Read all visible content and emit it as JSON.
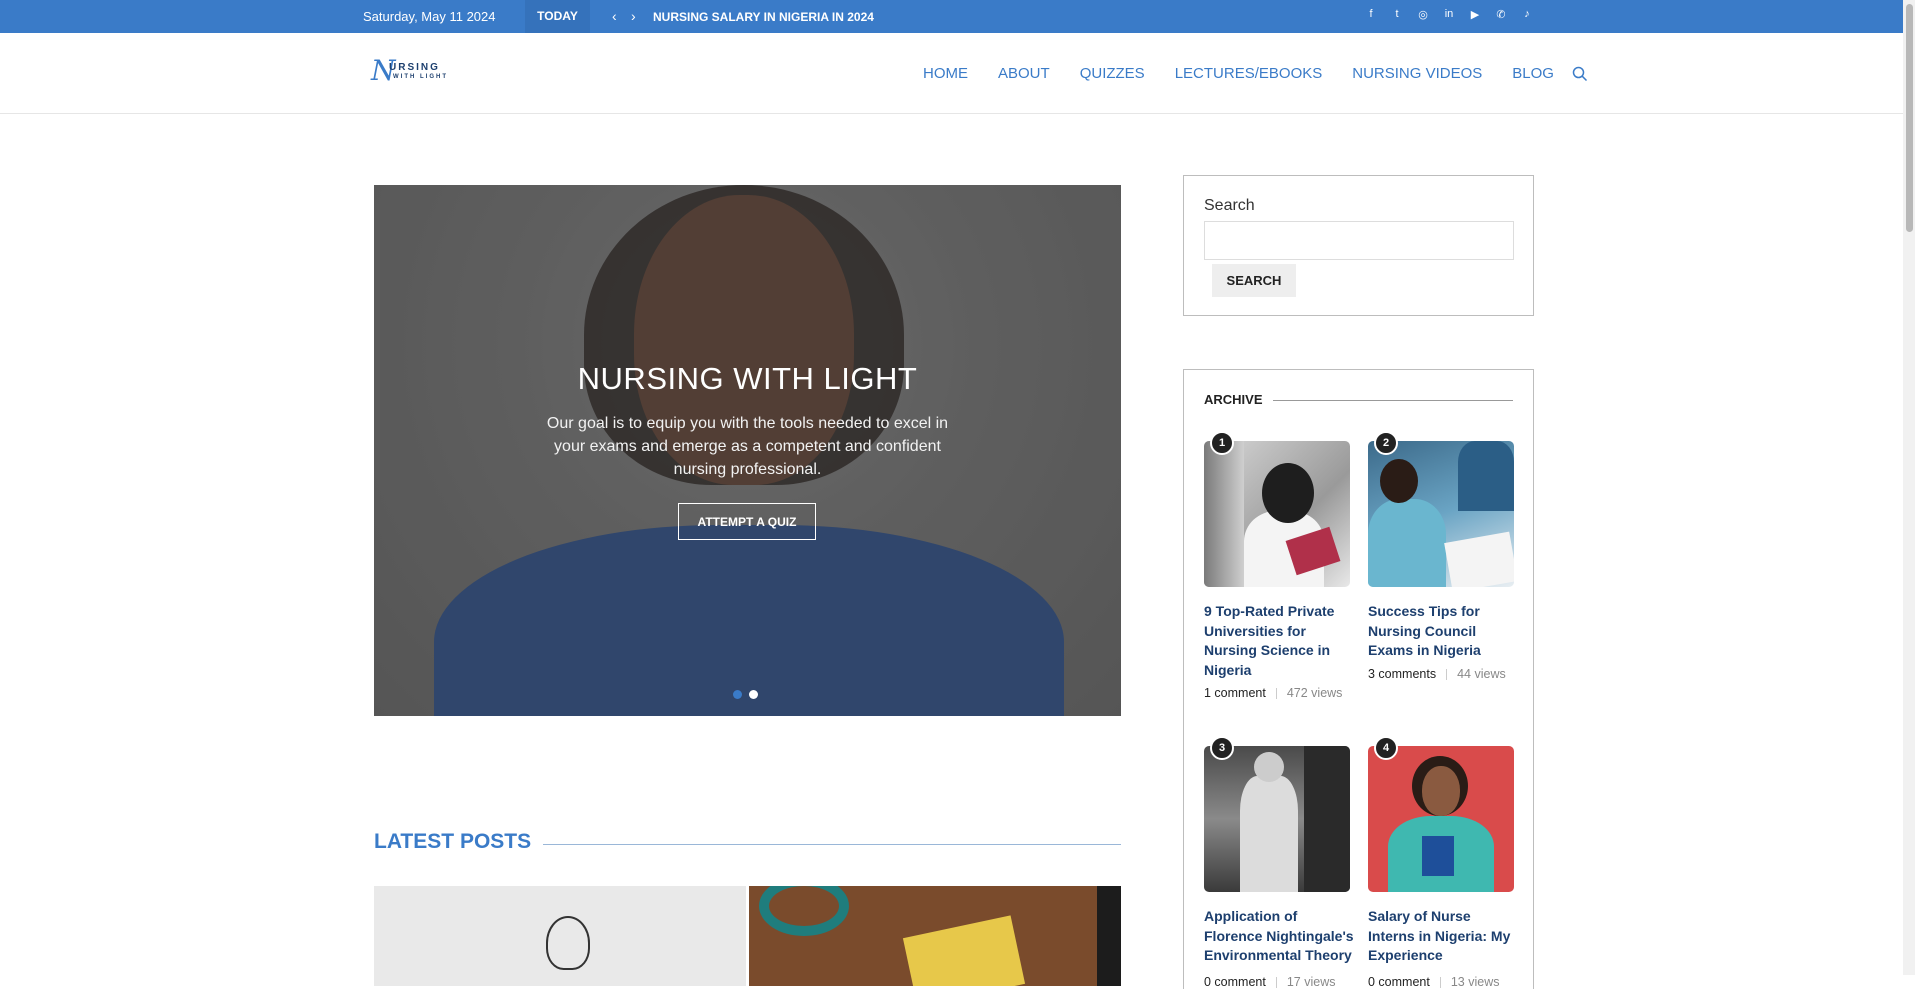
{
  "topbar": {
    "date": "Saturday, May 11 2024",
    "today_label": "TODAY",
    "prev_arrow": "‹",
    "next_arrow": "›",
    "ticker": "NURSING SALARY IN NIGERIA IN 2024",
    "socials": [
      {
        "icon": "facebook-icon",
        "glyph": "f"
      },
      {
        "icon": "twitter-icon",
        "glyph": "t"
      },
      {
        "icon": "instagram-icon",
        "glyph": "◎"
      },
      {
        "icon": "linkedin-icon",
        "glyph": "in"
      },
      {
        "icon": "youtube-icon",
        "glyph": "▶"
      },
      {
        "icon": "whatsapp-icon",
        "glyph": "✆"
      },
      {
        "icon": "tiktok-icon",
        "glyph": "♪"
      }
    ],
    "bg_color": "#3a7bc8"
  },
  "header": {
    "logo_line1": "URSING",
    "logo_line2": "WITH LIGHT",
    "logo_mark": "N",
    "menu": [
      "HOME",
      "ABOUT",
      "QUIZZES",
      "LECTURES/EBOOKS",
      "NURSING VIDEOS",
      "BLOG"
    ]
  },
  "slider": {
    "title": "NURSING WITH LIGHT",
    "description": "Our goal is to equip you with the tools needed to excel in your exams and emerge as a competent and confident nursing professional.",
    "cta": "ATTEMPT A QUIZ",
    "dots": 2,
    "active_dot": 1
  },
  "latest": {
    "heading": "LATEST POSTS"
  },
  "sidebar": {
    "search": {
      "label": "Search",
      "placeholder": "",
      "button": "SEARCH"
    },
    "archive": {
      "heading": "ARCHIVE",
      "items": [
        {
          "rank": "1",
          "title": "9 Top-Rated Private Universities for Nursing Science in Nigeria",
          "comments": "1 comment",
          "views": "472 views"
        },
        {
          "rank": "2",
          "title": "Success Tips for Nursing Council Exams in Nigeria",
          "comments": "3 comments",
          "views": "44 views"
        },
        {
          "rank": "3",
          "title": "Application of Florence Nightingale's Environmental Theory",
          "comments": "0 comment",
          "views": "17 views"
        },
        {
          "rank": "4",
          "title": "Salary of Nurse Interns in Nigeria: My Experience",
          "comments": "0 comment",
          "views": "13 views"
        }
      ]
    }
  },
  "colors": {
    "accent": "#3a7bc8",
    "title_dark": "#1d3f6e"
  }
}
